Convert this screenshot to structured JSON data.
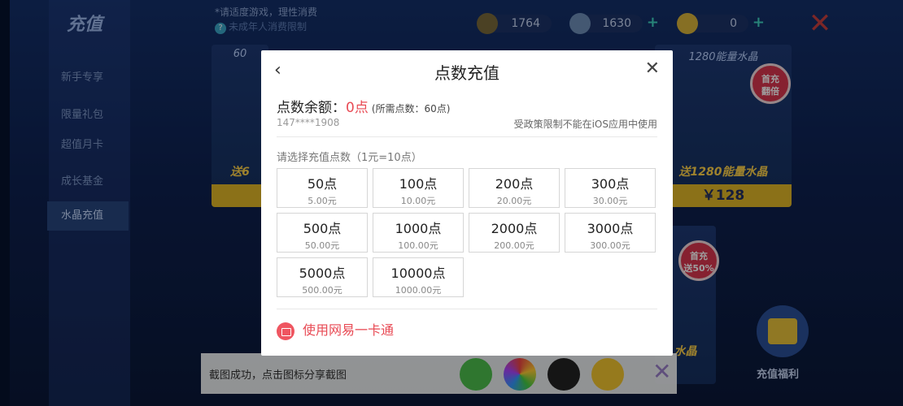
{
  "background": {
    "sidebar": {
      "title": "充值",
      "items": [
        {
          "label": "新手专享"
        },
        {
          "label": "限量礼包"
        },
        {
          "label": "超值月卡"
        },
        {
          "label": "成长基金"
        },
        {
          "label": "水晶充值",
          "active": true
        }
      ]
    },
    "notes": {
      "line1": "*请适度游戏，理性消费",
      "line2": "未成年人消费限制"
    },
    "currencies": [
      {
        "name": "coin",
        "value": "1764"
      },
      {
        "name": "diamond",
        "value": "1630"
      },
      {
        "name": "ticket",
        "value": "0"
      }
    ],
    "cards": [
      {
        "title": "60",
        "sub": "送6"
      },
      {
        "title": "1280能量水晶",
        "sub": "送1280能量水晶",
        "price": "￥128",
        "badge": "首充\n翻倍"
      },
      {
        "badge": "首充\n送50%"
      },
      {
        "sub": "水晶"
      }
    ],
    "gift_label": "充值福利",
    "share": {
      "text": "截图成功，点击图标分享截图"
    }
  },
  "modal": {
    "title": "点数充值",
    "balance_label": "点数余额：",
    "balance_value": "0点",
    "balance_need": "(所需点数：60点)",
    "account": "147****1908",
    "policy": "受政策限制不能在iOS应用中使用",
    "choose_label": "请选择充值点数（1元=10点）",
    "options": [
      {
        "points": "50点",
        "price": "5.00元"
      },
      {
        "points": "100点",
        "price": "10.00元"
      },
      {
        "points": "200点",
        "price": "20.00元"
      },
      {
        "points": "300点",
        "price": "30.00元"
      },
      {
        "points": "500点",
        "price": "50.00元"
      },
      {
        "points": "1000点",
        "price": "100.00元"
      },
      {
        "points": "2000点",
        "price": "200.00元"
      },
      {
        "points": "3000点",
        "price": "300.00元"
      },
      {
        "points": "5000点",
        "price": "500.00元"
      },
      {
        "points": "10000点",
        "price": "1000.00元"
      }
    ],
    "yikatong_label": "使用网易一卡通"
  },
  "colors": {
    "accent_red": "#e84a54",
    "game_bg": "#0e2150",
    "gold": "#e0b628"
  }
}
